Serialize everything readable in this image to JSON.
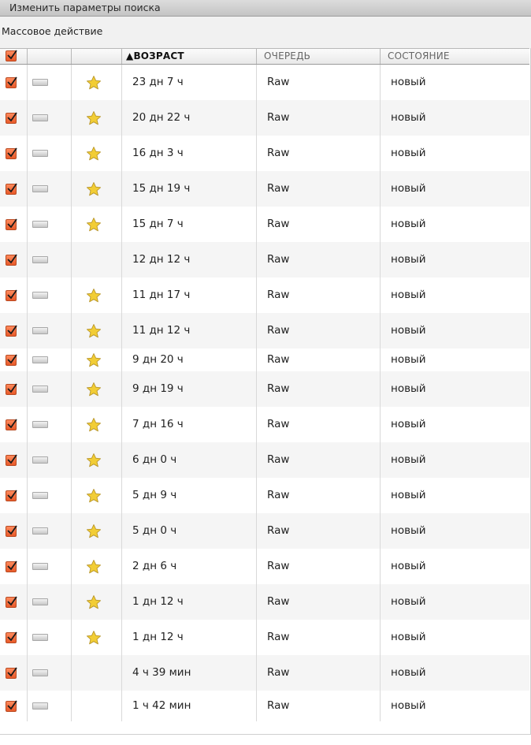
{
  "topbar": {
    "edit_search_label": "Изменить параметры поиска"
  },
  "bulk": {
    "label": "Массовое действие"
  },
  "header": {
    "select_all_checked": true,
    "sort_arrow": "▲",
    "age": "ВОЗРАСТ",
    "queue": "ОЧЕРЕДЬ",
    "state": "СОСТОЯНИЕ"
  },
  "colors": {
    "checkbox": "#ec6a3a",
    "star": "#f2cd35"
  },
  "rows": [
    {
      "checked": true,
      "star": true,
      "age": "23 дн 7 ч",
      "queue": "Raw",
      "state": "новый"
    },
    {
      "checked": true,
      "star": true,
      "age": "20 дн 22 ч",
      "queue": "Raw",
      "state": "новый"
    },
    {
      "checked": true,
      "star": true,
      "age": "16 дн 3 ч",
      "queue": "Raw",
      "state": "новый"
    },
    {
      "checked": true,
      "star": true,
      "age": "15 дн 19 ч",
      "queue": "Raw",
      "state": "новый"
    },
    {
      "checked": true,
      "star": true,
      "age": "15 дн 7 ч",
      "queue": "Raw",
      "state": "новый"
    },
    {
      "checked": true,
      "star": false,
      "age": "12 дн 12 ч",
      "queue": "Raw",
      "state": "новый"
    },
    {
      "checked": true,
      "star": true,
      "age": "11 дн 17 ч",
      "queue": "Raw",
      "state": "новый"
    },
    {
      "checked": true,
      "star": true,
      "age": "11 дн 12 ч",
      "queue": "Raw",
      "state": "новый"
    },
    {
      "checked": true,
      "star": true,
      "age": "9 дн 20 ч",
      "queue": "Raw",
      "state": "новый"
    },
    {
      "checked": true,
      "star": true,
      "age": "9 дн 19 ч",
      "queue": "Raw",
      "state": "новый"
    },
    {
      "checked": true,
      "star": true,
      "age": "7 дн 16 ч",
      "queue": "Raw",
      "state": "новый"
    },
    {
      "checked": true,
      "star": true,
      "age": "6 дн 0 ч",
      "queue": "Raw",
      "state": "новый"
    },
    {
      "checked": true,
      "star": true,
      "age": "5 дн 9 ч",
      "queue": "Raw",
      "state": "новый"
    },
    {
      "checked": true,
      "star": true,
      "age": "5 дн 0 ч",
      "queue": "Raw",
      "state": "новый"
    },
    {
      "checked": true,
      "star": true,
      "age": "2 дн 6 ч",
      "queue": "Raw",
      "state": "новый"
    },
    {
      "checked": true,
      "star": true,
      "age": "1 дн 12 ч",
      "queue": "Raw",
      "state": "новый"
    },
    {
      "checked": true,
      "star": true,
      "age": "1 дн 12 ч",
      "queue": "Raw",
      "state": "новый"
    },
    {
      "checked": true,
      "star": false,
      "age": "4 ч 39 мин",
      "queue": "Raw",
      "state": "новый"
    },
    {
      "checked": true,
      "star": false,
      "age": "1 ч 42 мин",
      "queue": "Raw",
      "state": "новый"
    }
  ]
}
